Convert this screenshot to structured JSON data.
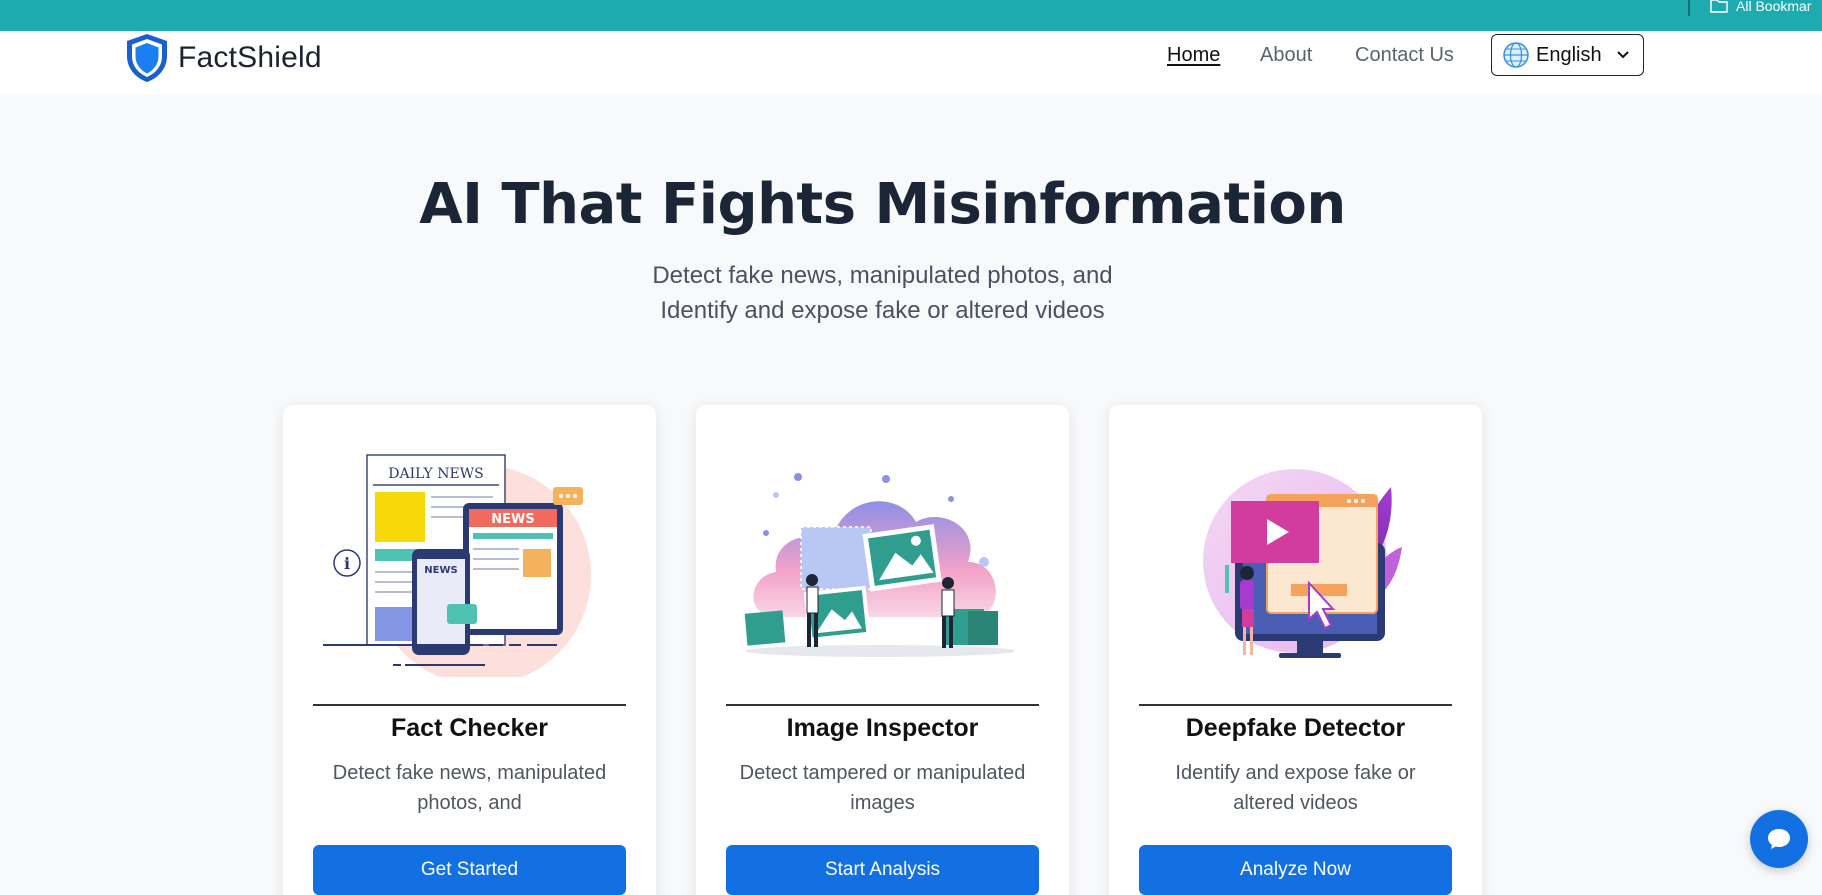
{
  "browser": {
    "bookmarks_label": "All Bookmar"
  },
  "nav": {
    "brand": "FactShield",
    "links": [
      {
        "label": "Home",
        "active": true
      },
      {
        "label": "About",
        "active": false
      },
      {
        "label": "Contact Us",
        "active": false
      }
    ],
    "language": {
      "selected": "English"
    }
  },
  "hero": {
    "title": "AI That Fights Misinformation",
    "subtitle_line1": "Detect fake news, manipulated photos, and",
    "subtitle_line2": "Identify and expose fake or altered videos"
  },
  "cards": [
    {
      "title": "Fact Checker",
      "description": "Detect fake news, manipulated photos, and",
      "button": "Get Started",
      "illustration_text_1": "DAILY NEWS",
      "illustration_text_2": "NEWS",
      "illustration_text_3": "NEWS"
    },
    {
      "title": "Image Inspector",
      "description": "Detect tampered or manipulated images",
      "button": "Start Analysis"
    },
    {
      "title": "Deepfake Detector",
      "description": "Identify and expose fake or altered videos",
      "button": "Analyze Now"
    }
  ],
  "colors": {
    "accent": "#1270e3",
    "bookmark_bar": "#1eabb0",
    "heading": "#1c2536"
  },
  "icons": {
    "brand": "shield-icon",
    "language": "globe-icon",
    "chat": "chat-bubble-icon"
  }
}
